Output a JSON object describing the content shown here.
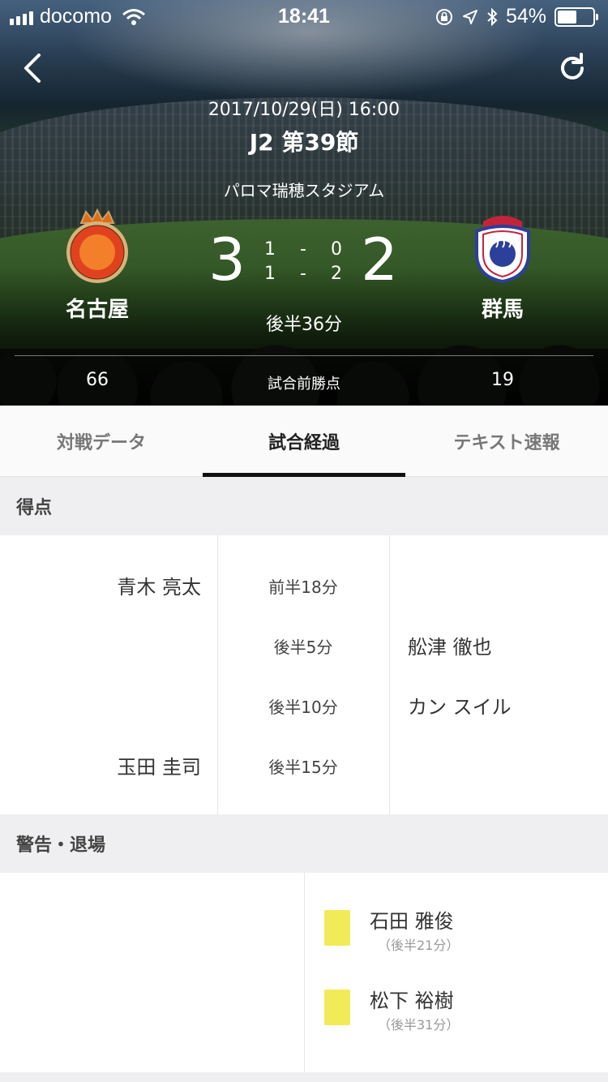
{
  "status_bar": {
    "carrier": "docomo",
    "time": "18:41",
    "battery_text": "54%",
    "battery_level": 0.54
  },
  "match": {
    "date": "2017/10/29(日) 16:00",
    "round": "J2 第39節",
    "venue": "パロマ瑞穂スタジアム",
    "status": "後半36分",
    "home": {
      "name": "名古屋",
      "score": "3",
      "points": "66"
    },
    "away": {
      "name": "群馬",
      "score": "2",
      "points": "19"
    },
    "halves": [
      {
        "home": "1",
        "sep": "-",
        "away": "0"
      },
      {
        "home": "1",
        "sep": "-",
        "away": "2"
      }
    ],
    "points_label": "試合前勝点"
  },
  "tabs": [
    {
      "label": "対戦データ",
      "active": false
    },
    {
      "label": "試合経過",
      "active": true
    },
    {
      "label": "テキスト速報",
      "active": false
    }
  ],
  "goals": {
    "title": "得点",
    "rows": [
      {
        "home": "青木 亮太",
        "time": "前半18分",
        "away": ""
      },
      {
        "home": "",
        "time": "後半5分",
        "away": "舩津 徹也"
      },
      {
        "home": "",
        "time": "後半10分",
        "away": "カン スイル"
      },
      {
        "home": "玉田 圭司",
        "time": "後半15分",
        "away": ""
      }
    ]
  },
  "cards": {
    "title": "警告・退場",
    "away": [
      {
        "player": "石田 雅俊",
        "time": "（後半21分）",
        "type": "yellow"
      },
      {
        "player": "松下 裕樹",
        "time": "（後半31分）",
        "type": "yellow"
      }
    ]
  },
  "colors": {
    "yellow_card": "#f2eb58",
    "tab_indicator": "#111111"
  }
}
